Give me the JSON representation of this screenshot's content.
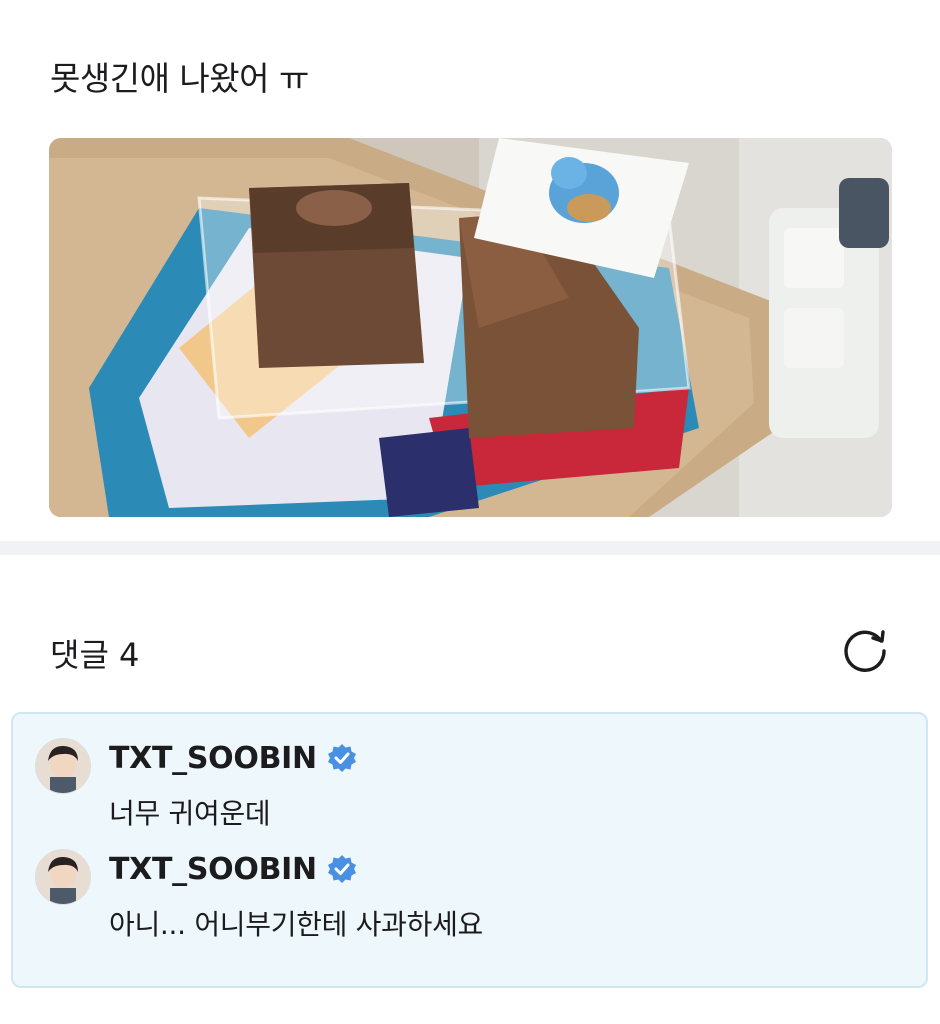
{
  "post": {
    "text": "못생긴애 나왔어 ㅠ"
  },
  "comments_section": {
    "title": "댓글 4"
  },
  "comments": [
    {
      "author": "TXT_SOOBIN",
      "body": "너무 귀여운데"
    },
    {
      "author": "TXT_SOOBIN",
      "body": "아니... 어니부기한테 사과하세요"
    }
  ],
  "icons": {
    "refresh": "refresh-icon",
    "verified": "verified-badge-icon"
  },
  "colors": {
    "comment_bg": "#eef8fc",
    "comment_border": "#cfe7f1",
    "verified": "#4a90e2",
    "divider": "#f1f2f6"
  }
}
